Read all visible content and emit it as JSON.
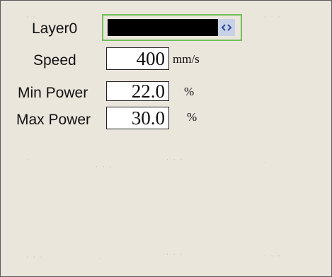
{
  "layer": {
    "label": "Layer0",
    "selected_value": ""
  },
  "speed": {
    "label": "Speed",
    "value": "400",
    "unit": "mm/s"
  },
  "min_power": {
    "label": "Min Power",
    "value": "22.0",
    "unit": "%"
  },
  "max_power": {
    "label": "Max Power",
    "value": "30.0",
    "unit": "%"
  },
  "icons": {
    "layer_spinner": "left-right-arrows-icon"
  },
  "colors": {
    "panel_bg": "#ebe6dc",
    "focus_border": "#6fbf5a",
    "spinner_bg": "#c8d2e6"
  }
}
